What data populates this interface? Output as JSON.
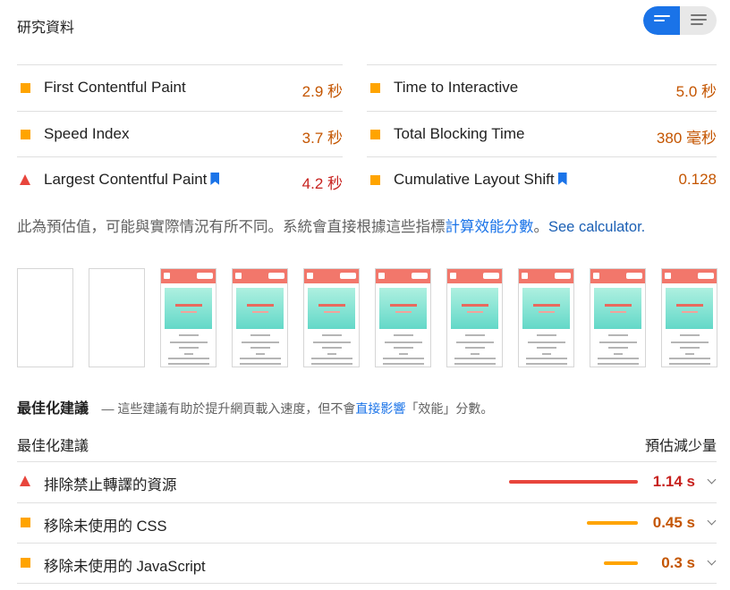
{
  "header": {
    "title": "研究資料"
  },
  "view_toggle": {
    "left_icon": "bars-icon",
    "right_icon": "list-icon"
  },
  "metrics": [
    {
      "label": "First Contentful Paint",
      "value": "2.9 秒",
      "status": "average",
      "bookmark": false
    },
    {
      "label": "Speed Index",
      "value": "3.7 秒",
      "status": "average",
      "bookmark": false
    },
    {
      "label": "Largest Contentful Paint",
      "value": "4.2 秒",
      "status": "fail",
      "bookmark": true
    },
    {
      "label": "Time to Interactive",
      "value": "5.0 秒",
      "status": "average",
      "bookmark": false
    },
    {
      "label": "Total Blocking Time",
      "value": "380 毫秒",
      "status": "average",
      "bookmark": false
    },
    {
      "label": "Cumulative Layout Shift",
      "value": "0.128",
      "status": "average",
      "bookmark": true
    }
  ],
  "disclaimer": {
    "text": "此為預估值，可能與實際情況有所不同。系統會直接根據這些指標",
    "link": "計算效能分數",
    "punct": "。",
    "calc_link": "See calculator."
  },
  "filmstrip": {
    "frames": 10,
    "blank_frames": 2
  },
  "opportunities": {
    "title": "最佳化建議",
    "subtitle_prefix": "— 這些建議有助於提升網頁載入速度，但不會",
    "subtitle_link": "直接影響",
    "subtitle_suffix": "「效能」分數。",
    "col_left": "最佳化建議",
    "col_right": "預估減少量",
    "items": [
      {
        "label": "排除禁止轉譯的資源",
        "value": "1.14 s",
        "status": "fail",
        "bar_fraction": 1.0
      },
      {
        "label": "移除未使用的 CSS",
        "value": "0.45 s",
        "status": "average",
        "bar_fraction": 0.395
      },
      {
        "label": "移除未使用的 JavaScript",
        "value": "0.3 s",
        "status": "average",
        "bar_fraction": 0.263
      }
    ]
  },
  "colors": {
    "accent": "#1a73e8",
    "average": "#ffa400",
    "fail": "#e8453c"
  }
}
